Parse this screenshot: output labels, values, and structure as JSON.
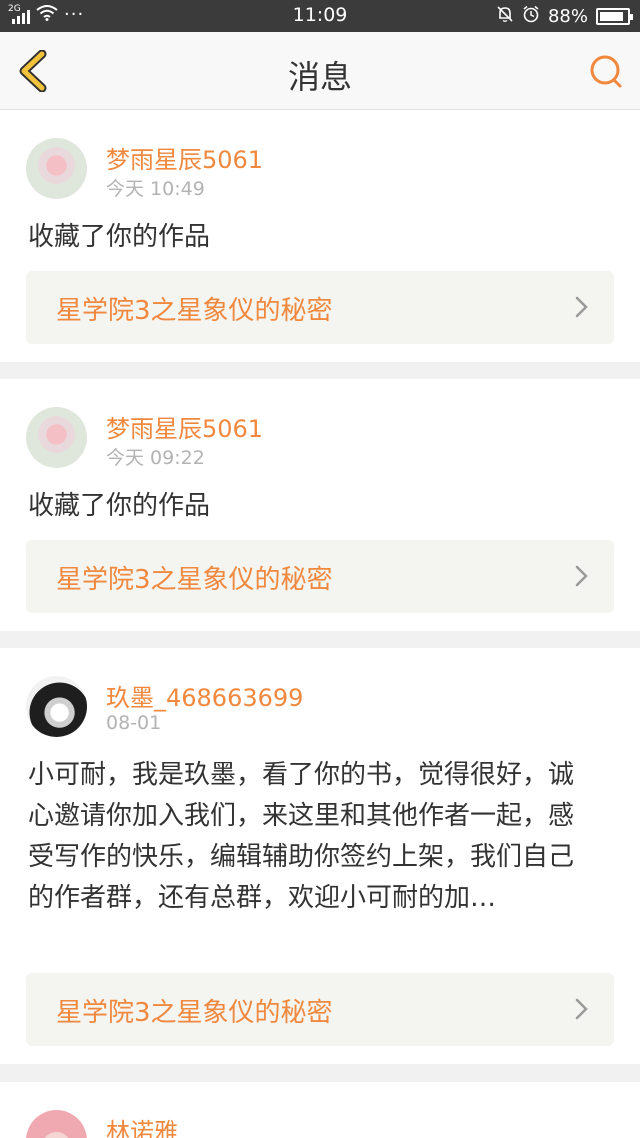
{
  "status_bar": {
    "network": "2G",
    "dots": "···",
    "time": "11:09",
    "battery": "88%",
    "battery_level": 0.88
  },
  "header": {
    "title": "消息"
  },
  "messages": [
    {
      "user": "梦雨星辰5061",
      "time": "今天 10:49",
      "text": "收藏了你的作品",
      "book": "星学院3之星象仪的秘密"
    },
    {
      "user": "梦雨星辰5061",
      "time": "今天 09:22",
      "text": "收藏了你的作品",
      "book": "星学院3之星象仪的秘密"
    },
    {
      "user": "玖墨_468663699",
      "time": "08-01",
      "text": "小可耐，我是玖墨，看了你的书，觉得很好，诚心邀请你加入我们，来这里和其他作者一起，感受写作的快乐，编辑辅助你签约上架，我们自己的作者群，还有总群，欢迎小可耐的加…",
      "book": "星学院3之星象仪的秘密"
    },
    {
      "user": "林诺雅"
    }
  ],
  "colors": {
    "accent": "#f0883e",
    "back_icon": "#f2c33a",
    "status_bar_bg": "#3b3b3b"
  }
}
